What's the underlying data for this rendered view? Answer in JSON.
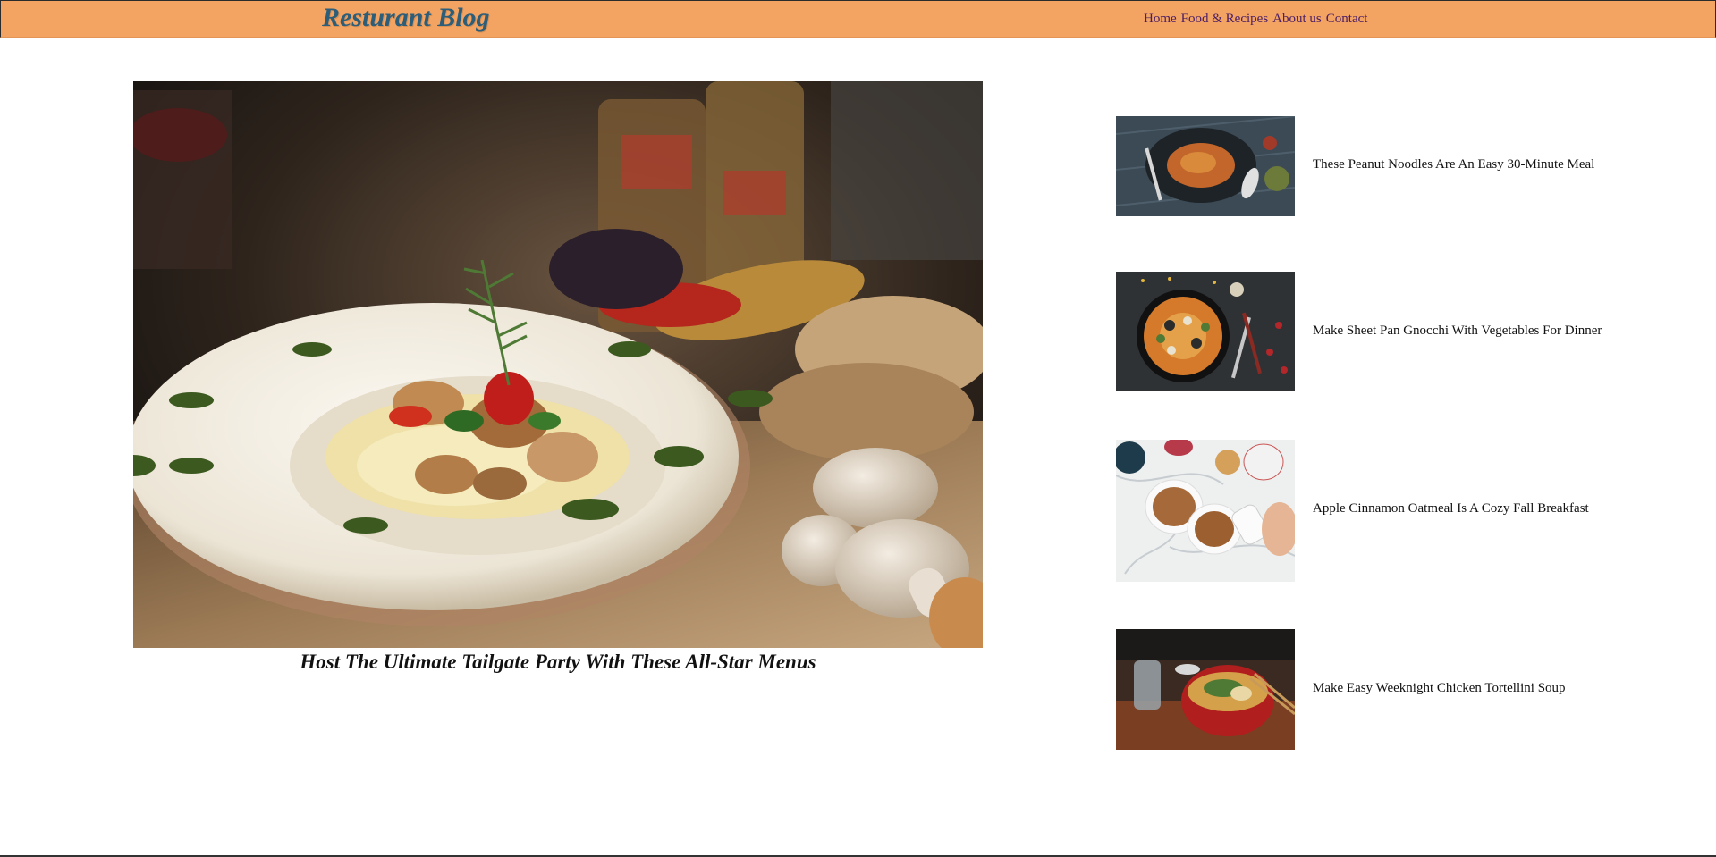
{
  "header": {
    "brand": "Resturant Blog",
    "nav": [
      "Home",
      "Food & Recipes",
      "About us",
      "Contact"
    ]
  },
  "featured": {
    "title": "Host The Ultimate Tailgate Party With These All-Star Menus",
    "image": "pasta-plate-photo"
  },
  "sidebar": {
    "items": [
      {
        "title": "These Peanut Noodles Are An Easy 30-Minute Meal",
        "image": "peanut-noodles-photo"
      },
      {
        "title": "Make Sheet Pan Gnocchi With Vegetables For Dinner",
        "image": "paella-pan-photo"
      },
      {
        "title": "Apple Cinnamon Oatmeal Is A Cozy Fall Breakfast",
        "image": "oatmeal-bowls-photo"
      },
      {
        "title": "Make Easy Weeknight Chicken Tortellini Soup",
        "image": "ramen-bowl-photo"
      }
    ]
  },
  "colors": {
    "header_bg": "#f4a462",
    "brand": "#2c5d79",
    "nav_link": "#4a1d66"
  }
}
